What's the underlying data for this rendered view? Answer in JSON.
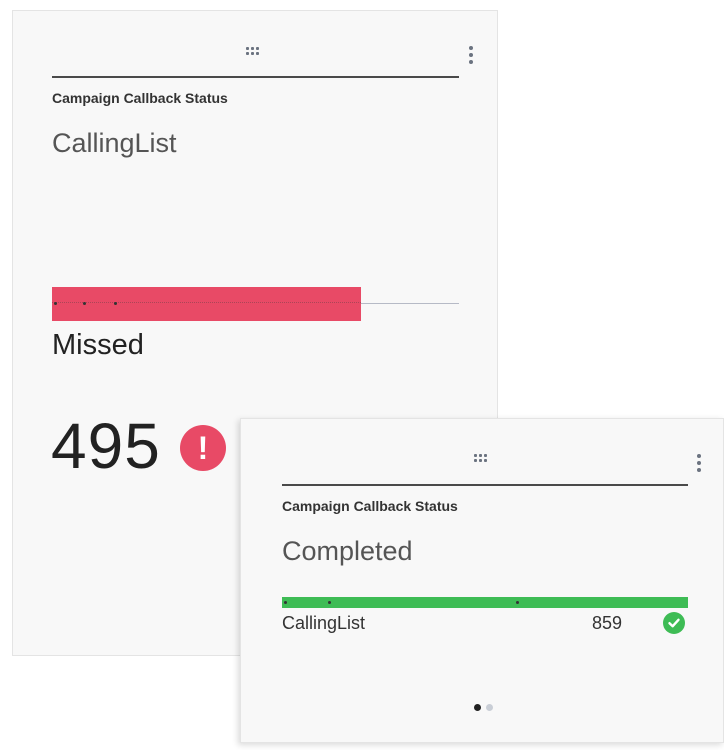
{
  "colors": {
    "missed": "#e84a66",
    "completed": "#3ebc55",
    "dot_active": "#222222",
    "dot_inactive": "#c9ced6"
  },
  "widget_missed": {
    "title": "Campaign Callback Status",
    "subtitle": "CallingList",
    "status_label": "Missed",
    "count": "495",
    "alert_icon": "exclamation-circle-icon",
    "alert_glyph": "!",
    "bar_fraction": 0.76
  },
  "widget_completed": {
    "title": "Campaign Callback Status",
    "subtitle": "Completed",
    "bar_fraction": 1.0,
    "rows": [
      {
        "label": "CallingList",
        "count": "859",
        "icon": "check-circle-icon"
      }
    ]
  },
  "pager": {
    "total": 2,
    "active": 0
  }
}
